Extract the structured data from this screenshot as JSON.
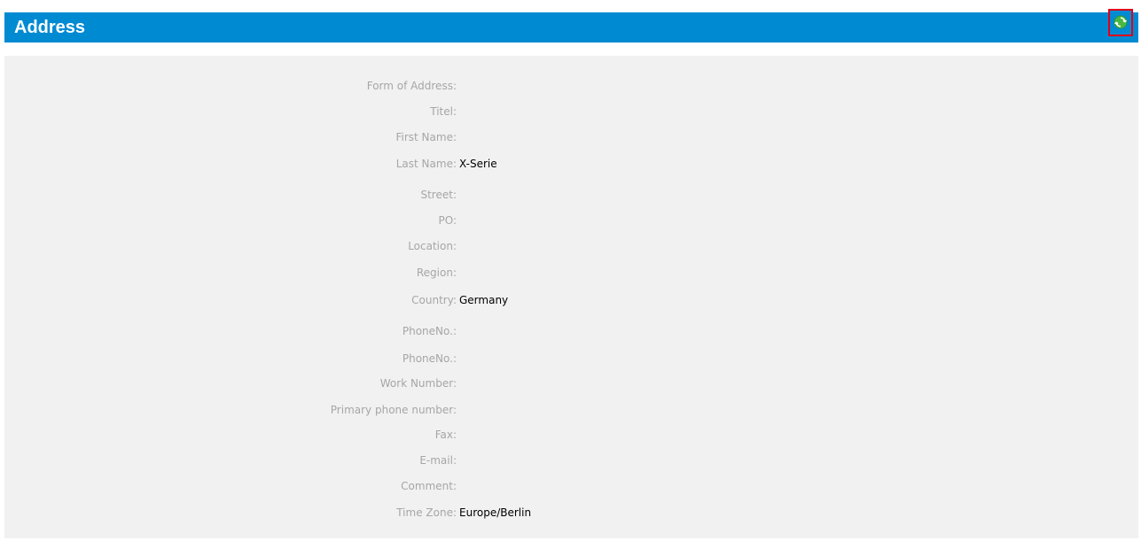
{
  "header": {
    "title": "Address",
    "refresh_icon": "refresh-icon",
    "accent_color": "#008ad2",
    "highlight_color": "#e0001a"
  },
  "fields": [
    {
      "label": "Form of Address:",
      "value": ""
    },
    {
      "label": "Titel:",
      "value": ""
    },
    {
      "label": "First Name:",
      "value": ""
    },
    {
      "label": "Last Name:",
      "value": "X-Serie"
    },
    {
      "label": "Street:",
      "value": ""
    },
    {
      "label": "PO:",
      "value": ""
    },
    {
      "label": "Location:",
      "value": ""
    },
    {
      "label": "Region:",
      "value": ""
    },
    {
      "label": "Country:",
      "value": "Germany"
    },
    {
      "label": "PhoneNo.:",
      "value": ""
    },
    {
      "label": "PhoneNo.:",
      "value": ""
    },
    {
      "label": "Work Number:",
      "value": ""
    },
    {
      "label": "Primary phone number:",
      "value": ""
    },
    {
      "label": "Fax:",
      "value": ""
    },
    {
      "label": "E-mail:",
      "value": ""
    },
    {
      "label": "Comment:",
      "value": ""
    },
    {
      "label": "Time Zone:",
      "value": "Europe/Berlin"
    }
  ]
}
